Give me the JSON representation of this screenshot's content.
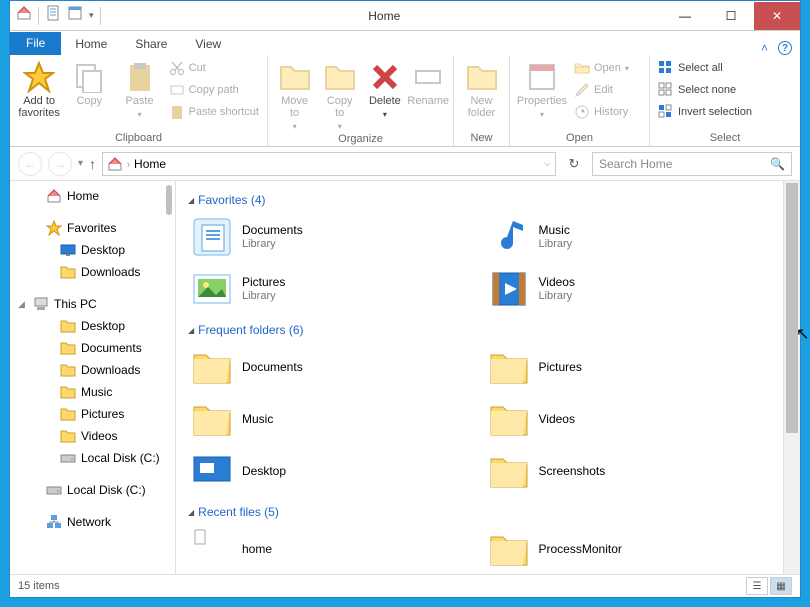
{
  "window": {
    "title": "Home"
  },
  "tabs": {
    "file": "File",
    "home": "Home",
    "share": "Share",
    "view": "View"
  },
  "ribbon": {
    "add_fav": "Add to\nfavorites",
    "copy": "Copy",
    "paste": "Paste",
    "cut": "Cut",
    "copy_path": "Copy path",
    "paste_shortcut": "Paste shortcut",
    "clipboard": "Clipboard",
    "move_to": "Move\nto",
    "copy_to": "Copy\nto",
    "delete": "Delete",
    "rename": "Rename",
    "organize": "Organize",
    "new_folder": "New\nfolder",
    "new": "New",
    "properties": "Properties",
    "open_btn": "Open",
    "edit": "Edit",
    "history": "History",
    "open": "Open",
    "select_all": "Select all",
    "select_none": "Select none",
    "invert": "Invert selection",
    "select": "Select"
  },
  "addr": {
    "path": "Home",
    "search_placeholder": "Search Home"
  },
  "nav": {
    "home": "Home",
    "favorites": "Favorites",
    "desktop": "Desktop",
    "downloads": "Downloads",
    "this_pc": "This PC",
    "documents": "Documents",
    "music": "Music",
    "pictures": "Pictures",
    "videos": "Videos",
    "local_c": "Local Disk (C:)",
    "network": "Network"
  },
  "content": {
    "favorites_head": "Favorites (4)",
    "favorites": [
      {
        "name": "Documents",
        "sub": "Library"
      },
      {
        "name": "Music",
        "sub": "Library"
      },
      {
        "name": "Pictures",
        "sub": "Library"
      },
      {
        "name": "Videos",
        "sub": "Library"
      }
    ],
    "frequent_head": "Frequent folders (6)",
    "frequent": [
      {
        "name": "Documents"
      },
      {
        "name": "Pictures"
      },
      {
        "name": "Music"
      },
      {
        "name": "Videos"
      },
      {
        "name": "Desktop"
      },
      {
        "name": "Screenshots"
      }
    ],
    "recent_head": "Recent files (5)",
    "recent": [
      {
        "name": "home"
      },
      {
        "name": "ProcessMonitor"
      }
    ]
  },
  "status": {
    "count": "15 items"
  }
}
